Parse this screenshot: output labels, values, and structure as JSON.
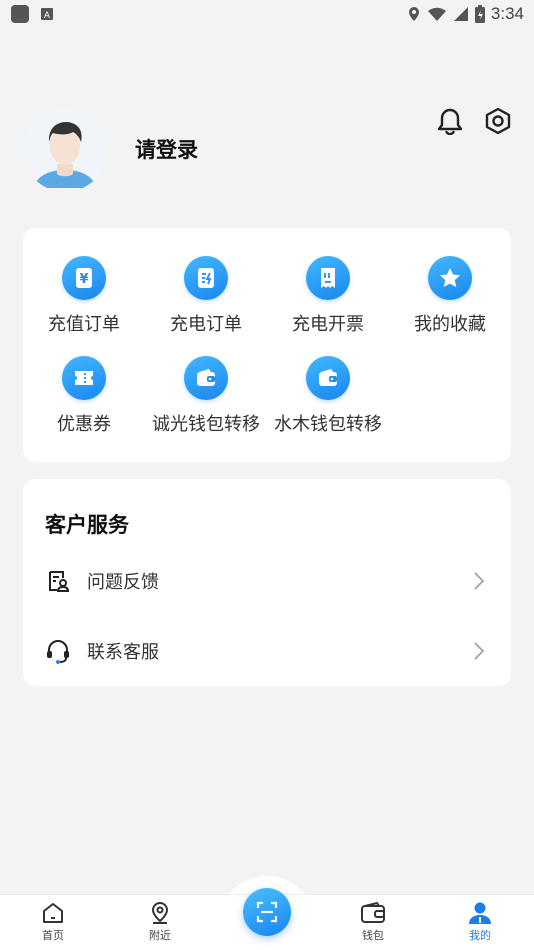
{
  "status_bar": {
    "time": "3:34"
  },
  "profile": {
    "login_text": "请登录"
  },
  "grid": [
    {
      "label": "充值订单",
      "icon": "recharge-order-icon"
    },
    {
      "label": "充电订单",
      "icon": "charge-order-icon"
    },
    {
      "label": "充电开票",
      "icon": "invoice-icon"
    },
    {
      "label": "我的收藏",
      "icon": "star-icon"
    },
    {
      "label": "优惠券",
      "icon": "coupon-icon"
    },
    {
      "label": "诚光钱包转移",
      "icon": "wallet-transfer-icon"
    },
    {
      "label": "水木钱包转移",
      "icon": "wallet-transfer-icon"
    }
  ],
  "service": {
    "title": "客户服务",
    "items": [
      {
        "label": "问题反馈",
        "icon": "feedback-icon"
      },
      {
        "label": "联系客服",
        "icon": "headset-icon"
      }
    ]
  },
  "tabbar": {
    "items": [
      {
        "label": "首页",
        "icon": "home-icon"
      },
      {
        "label": "附近",
        "icon": "location-icon"
      },
      {
        "label": "钱包",
        "icon": "wallet-icon"
      },
      {
        "label": "我的",
        "icon": "user-icon"
      }
    ],
    "active": "我的",
    "scan_icon": "scan-icon"
  },
  "colors": {
    "accent": "#1a80e8",
    "background": "#f3f3f3"
  }
}
